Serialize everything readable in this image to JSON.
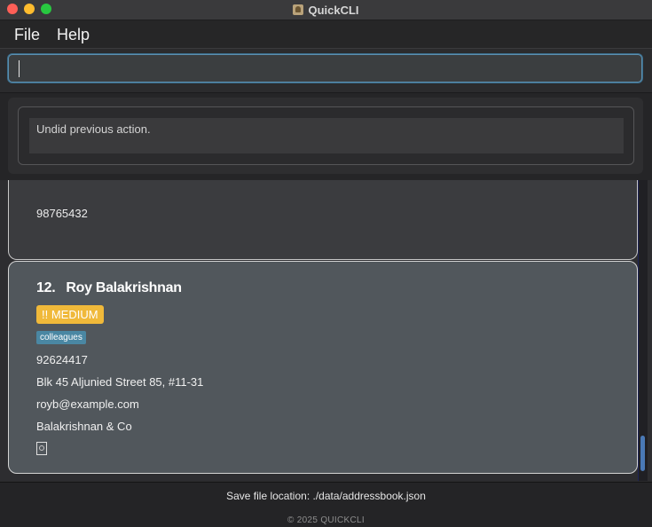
{
  "window": {
    "title": "QuickCLI"
  },
  "menu": {
    "file": "File",
    "help": "Help"
  },
  "command": {
    "value": ""
  },
  "result": {
    "message": "Undid previous action."
  },
  "list": {
    "previous_card": {
      "phone": "98765432"
    },
    "selected_card": {
      "index": "12.",
      "name": "Roy Balakrishnan",
      "priority": "!! MEDIUM",
      "tag": "colleagues",
      "phone": "92624417",
      "address": "Blk 45 Aljunied Street 85, #11-31",
      "email": "royb@example.com",
      "company": "Balakrishnan & Co"
    }
  },
  "status": {
    "save_location": "Save file location: ./data/addressbook.json",
    "copyright": "© 2025 QUICKCLI"
  },
  "colors": {
    "priority_medium": "#f0b93a",
    "tag": "#4a87a3",
    "focus": "#5b8fb0"
  }
}
